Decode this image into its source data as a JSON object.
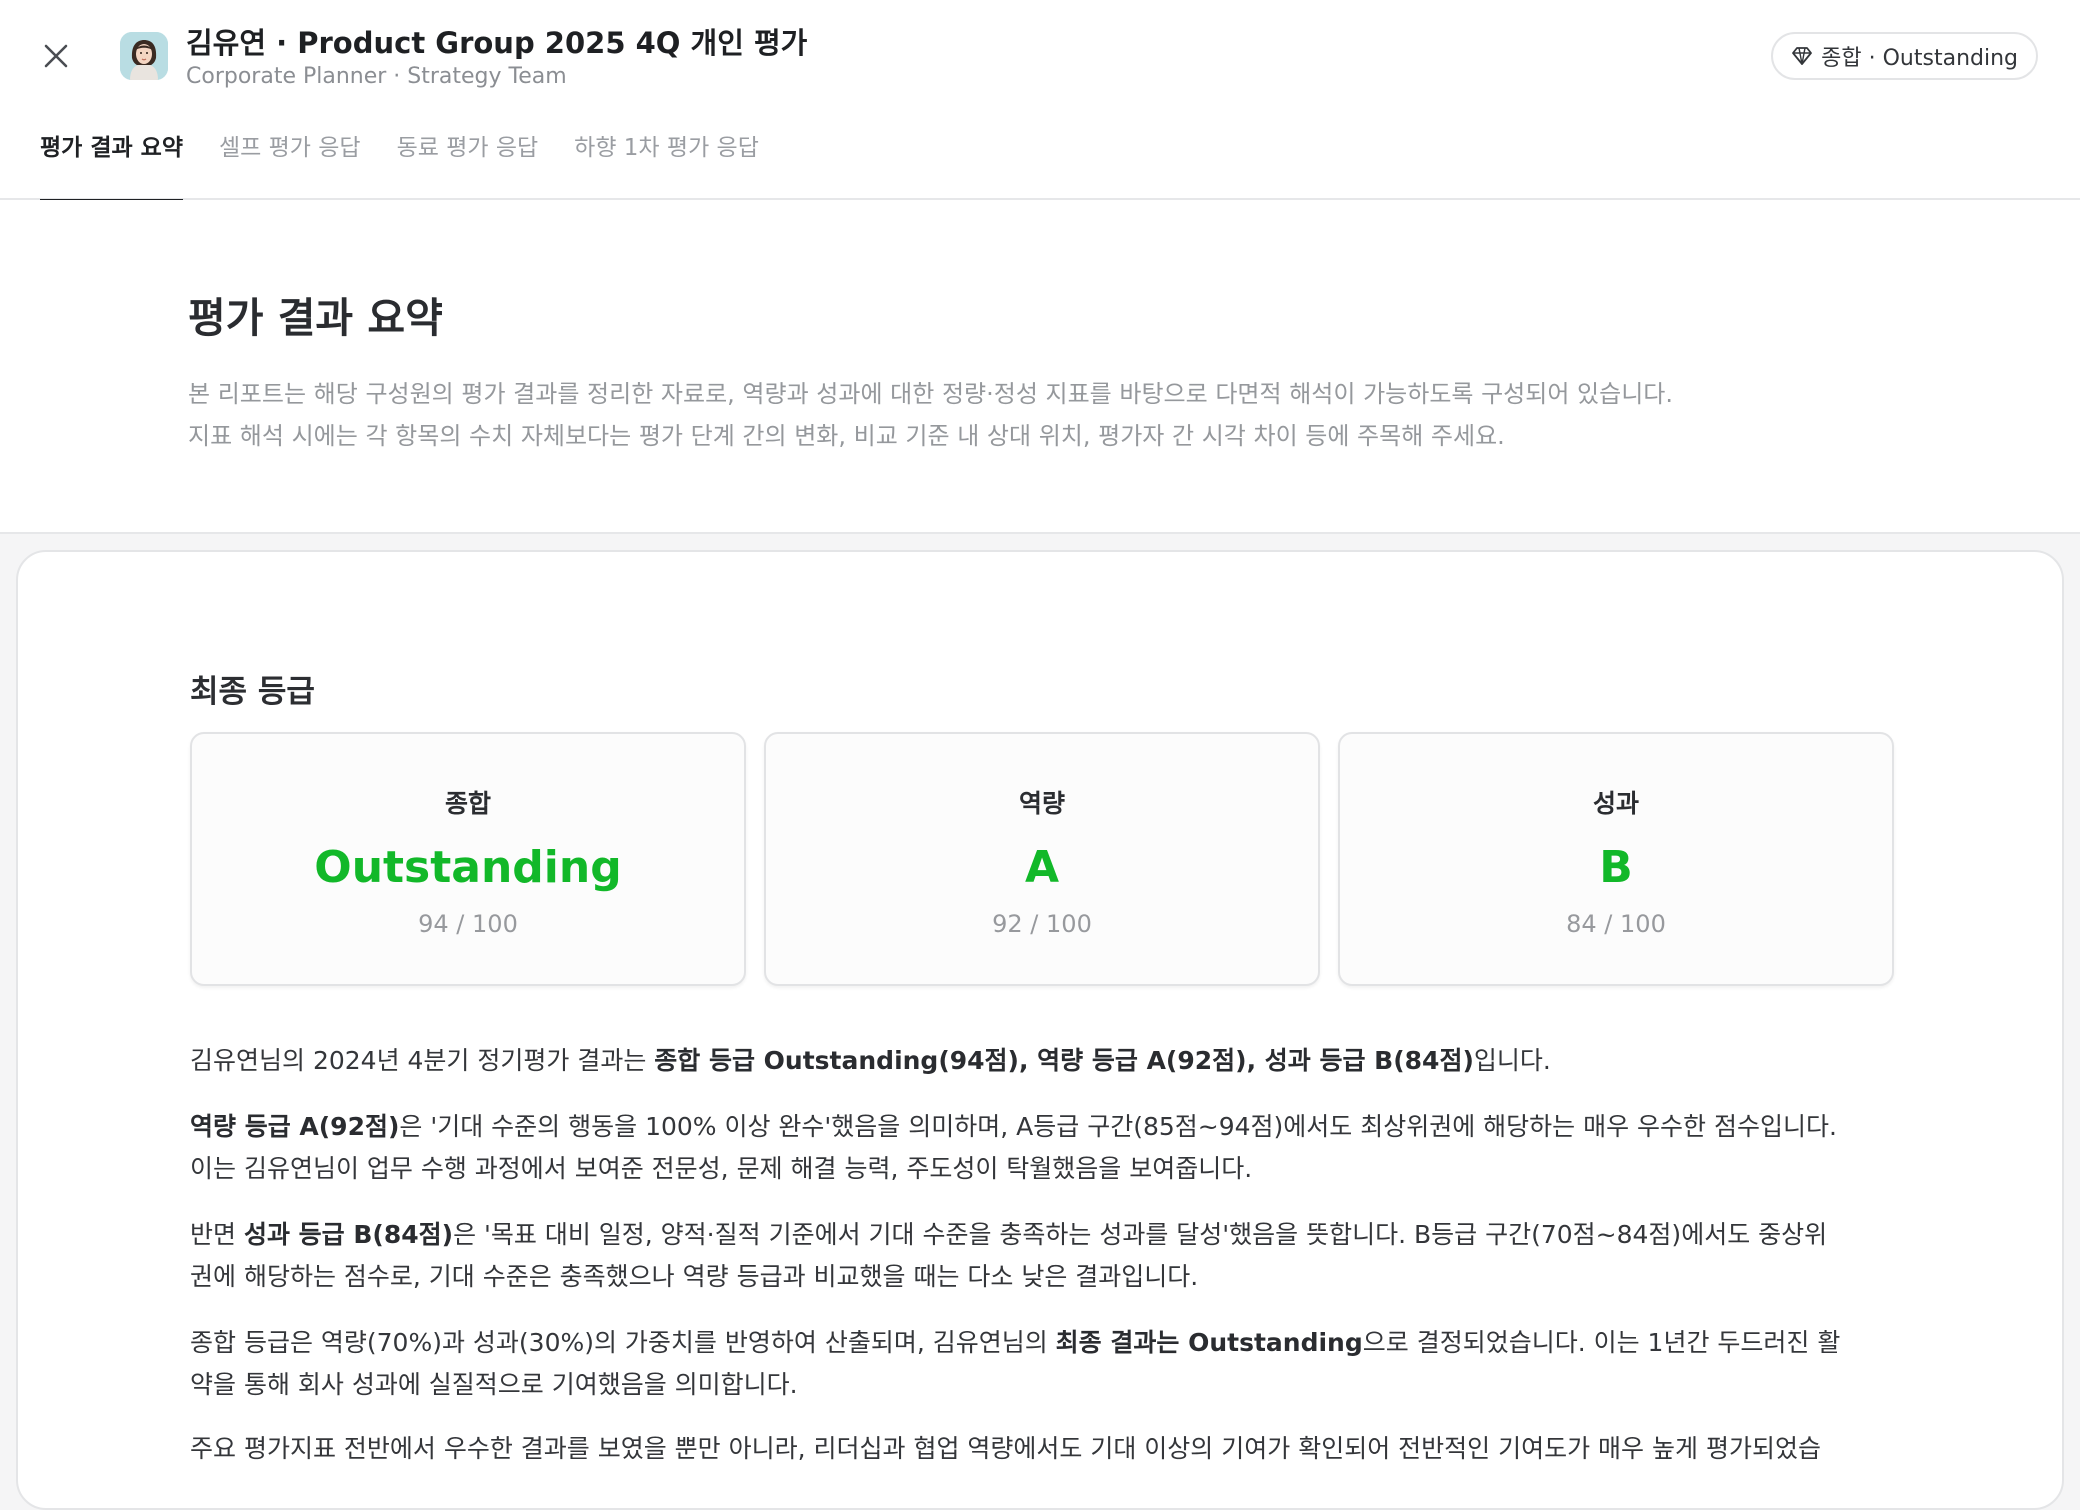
{
  "header": {
    "title": "김유연 · Product Group 2025 4Q 개인 평가",
    "subtitle": "Corporate Planner · Strategy Team",
    "grade_pill": "종합 · Outstanding",
    "tabs": [
      {
        "label": "평가 결과 요약",
        "active": true
      },
      {
        "label": "셀프 평가 응답",
        "active": false
      },
      {
        "label": "동료 평가 응답",
        "active": false
      },
      {
        "label": "하향 1차 평가 응답",
        "active": false
      }
    ]
  },
  "intro": {
    "title": "평가 결과 요약",
    "line1": "본 리포트는 해당 구성원의 평가 결과를 정리한 자료로, 역량과 성과에 대한 정량·정성 지표를 바탕으로 다면적 해석이 가능하도록 구성되어 있습니다.",
    "line2": "지표 해석 시에는 각 항목의 수치 자체보다는 평가 단계 간의 변화, 비교 기준 내 상대 위치, 평가자 간 시각 차이 등에 주목해 주세요."
  },
  "final_grade": {
    "section_title": "최종 등급",
    "cards": [
      {
        "label": "종합",
        "grade": "Outstanding",
        "score": "94 / 100"
      },
      {
        "label": "역량",
        "grade": "A",
        "score": "92 / 100"
      },
      {
        "label": "성과",
        "grade": "B",
        "score": "84 / 100"
      }
    ]
  },
  "summary": {
    "p1": {
      "a": "김유연님의 2024년 4분기 정기평가 결과는 ",
      "b": "종합 등급 Outstanding(94점), 역량 등급 A(92점), 성과 등급 B(84점)",
      "c": "입니다."
    },
    "p2": {
      "b": "역량 등급 A(92점)",
      "a1": "은 '기대 수준의 행동을 100% 이상 완수'했음을 의미하며, A등급 구간(85점~94점)에서도 최상위권에 해당하는 매우 우수한 점수입니다.",
      "a2": "이는 김유연님이 업무 수행 과정에서 보여준 전문성, 문제 해결 능력, 주도성이 탁월했음을 보여줍니다."
    },
    "p3": {
      "pre": "반면 ",
      "b": "성과 등급 B(84점)",
      "a1": "은 '목표 대비 일정, 양적·질적 기준에서 기대 수준을 충족하는 성과를 달성'했음을 뜻합니다. B등급 구간(70점~84점)에서도 중상위",
      "a2": "권에 해당하는 점수로, 기대 수준은 충족했으나 역량 등급과 비교했을 때는 다소 낮은 결과입니다."
    },
    "p4": {
      "a1": "종합 등급은 역량(70%)과 성과(30%)의 가중치를 반영하여 산출되며, 김유연님의 ",
      "b": "최종 결과는 Outstanding",
      "a2": "으로 결정되었습니다. 이는 1년간 두드러진 활",
      "a3": "약을 통해 회사 성과에 실질적으로 기여했음을 의미합니다."
    },
    "p5": "주요 평가지표 전반에서 우수한 결과를 보였을 뿐만 아니라, 리더십과 협업 역량에서도 기대 이상의 기여가 확인되어 전반적인 기여도가 매우 높게 평가되었습"
  },
  "colors": {
    "grade_green": "#12b829",
    "accent_dark": "#1f2124"
  }
}
